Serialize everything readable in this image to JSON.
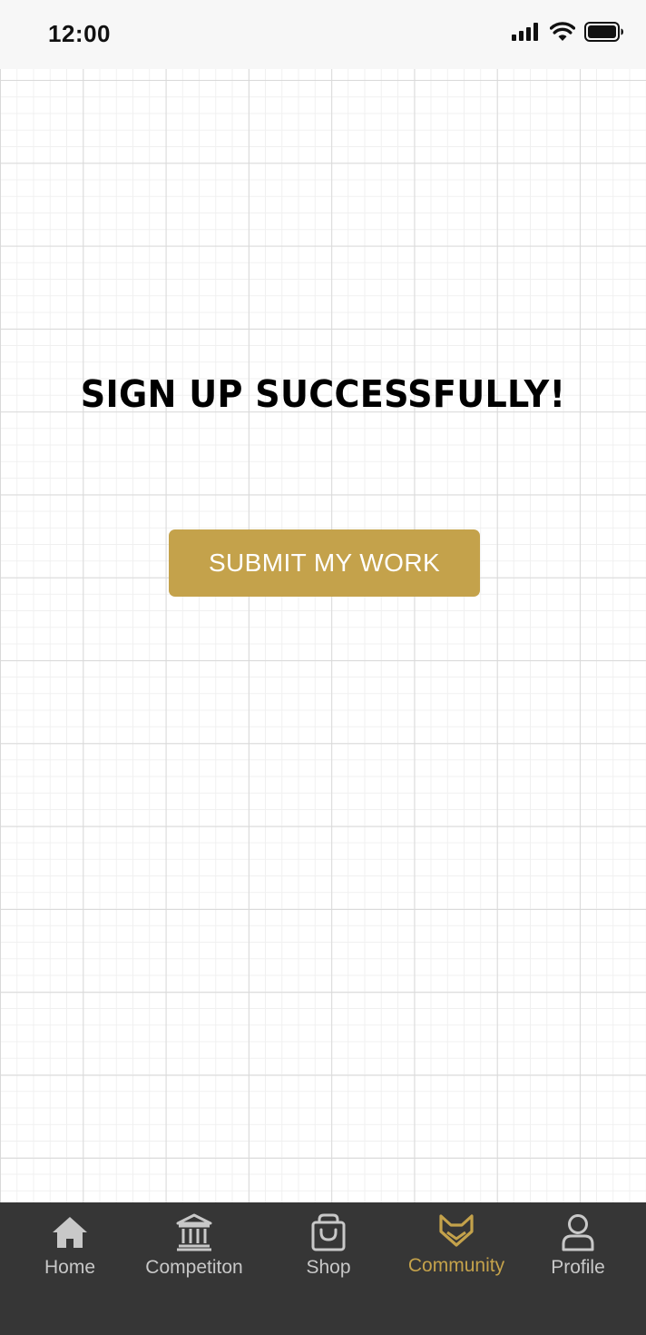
{
  "status_bar": {
    "time": "12:00",
    "icons": [
      "signal-icon",
      "wifi-icon",
      "battery-icon"
    ]
  },
  "main": {
    "headline": "SIGN UP SUCCESSFULLY!",
    "submit_label": "SUBMIT MY WORK"
  },
  "tab_bar": {
    "active": "Community",
    "items": [
      {
        "label": "Home",
        "icon": "home-icon"
      },
      {
        "label": "Competiton",
        "icon": "museum-icon"
      },
      {
        "label": "Shop",
        "icon": "shopping-bag-icon"
      },
      {
        "label": "Community",
        "icon": "fox-icon"
      },
      {
        "label": "Profile",
        "icon": "user-icon"
      }
    ]
  },
  "colors": {
    "accent": "#c4a24b",
    "tab_bar_bg": "#363636",
    "tab_inactive": "#c8c8c8",
    "status_bar_bg": "#f7f7f7"
  }
}
